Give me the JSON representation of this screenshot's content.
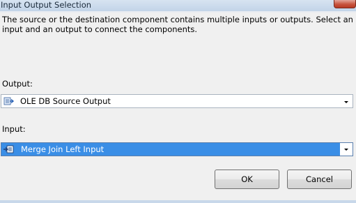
{
  "window": {
    "title": "Input Output Selection"
  },
  "description": "The source or the destination component contains multiple inputs or outputs. Select an input and an output to connect the components.",
  "output": {
    "label": "Output:",
    "selected_value": "OLE DB Source Output",
    "icon": "output-icon"
  },
  "input": {
    "label": "Input:",
    "selected_value": "Merge Join Left Input",
    "icon": "input-icon"
  },
  "buttons": {
    "ok": "OK",
    "cancel": "Cancel"
  },
  "colors": {
    "selection_highlight": "#3a8ee6",
    "close_button": "#c8533e"
  }
}
